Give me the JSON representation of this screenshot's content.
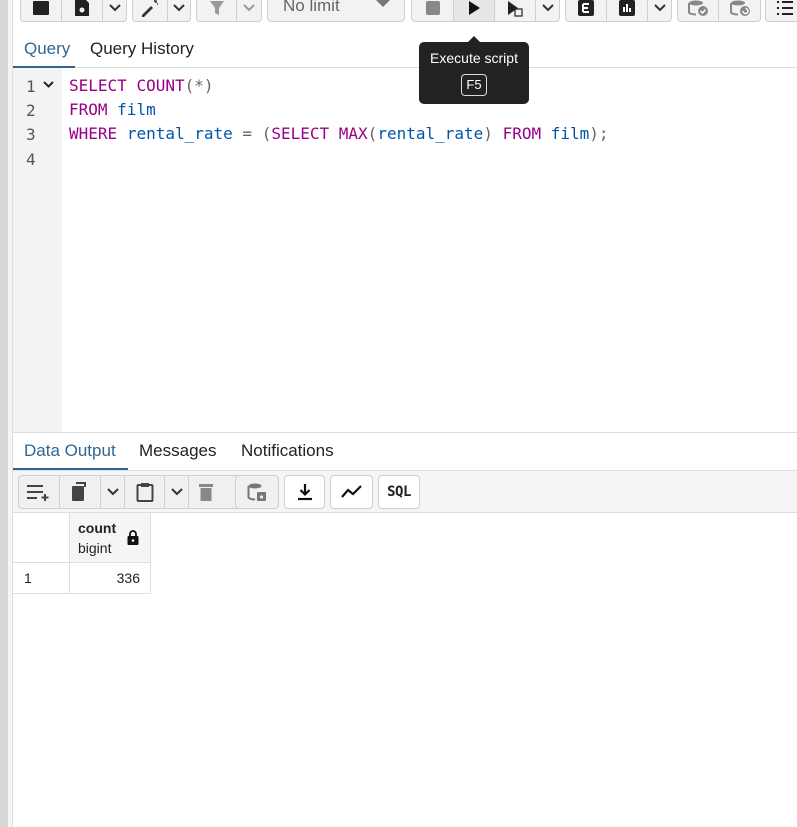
{
  "toolbar": {
    "limit_label": "No limit",
    "icons": [
      "open-file-icon",
      "save-icon",
      "chevron-down-icon",
      "edit-pen-icon",
      "chevron-down-icon",
      "filter-icon",
      "chevron-down-icon",
      "stop-icon",
      "execute-icon",
      "execute-explain-icon",
      "chevron-down-icon",
      "explain-icon",
      "explain-analyze-icon",
      "chevron-down-icon",
      "commit-icon",
      "rollback-icon",
      "macros-icon"
    ]
  },
  "tooltip": {
    "text": "Execute script",
    "shortcut": "F5"
  },
  "editor_tabs": [
    "Query",
    "Query History"
  ],
  "editor": {
    "line_numbers": [
      "1",
      "2",
      "3",
      "4"
    ],
    "lines": [
      [
        {
          "t": "SELECT",
          "c": "kw"
        },
        {
          "t": " ",
          "c": ""
        },
        {
          "t": "COUNT",
          "c": "kw"
        },
        {
          "t": "(*)",
          "c": "pu"
        }
      ],
      [
        {
          "t": "FROM",
          "c": "kw"
        },
        {
          "t": " ",
          "c": ""
        },
        {
          "t": "film",
          "c": "id"
        }
      ],
      [
        {
          "t": "WHERE",
          "c": "kw"
        },
        {
          "t": " ",
          "c": ""
        },
        {
          "t": "rental_rate",
          "c": "id"
        },
        {
          "t": " = ",
          "c": "pu"
        },
        {
          "t": "(",
          "c": "pu"
        },
        {
          "t": "SELECT",
          "c": "kw"
        },
        {
          "t": " ",
          "c": ""
        },
        {
          "t": "MAX",
          "c": "kw"
        },
        {
          "t": "(",
          "c": "pu"
        },
        {
          "t": "rental_rate",
          "c": "id"
        },
        {
          "t": ")",
          "c": "pu"
        },
        {
          "t": " ",
          "c": ""
        },
        {
          "t": "FROM",
          "c": "kw"
        },
        {
          "t": " ",
          "c": ""
        },
        {
          "t": "film",
          "c": "id"
        },
        {
          "t": ");",
          "c": "pu"
        }
      ],
      []
    ]
  },
  "output_tabs": [
    "Data Output",
    "Messages",
    "Notifications"
  ],
  "output_toolbar": {
    "sql_label": "SQL"
  },
  "result": {
    "columns": [
      {
        "name": "count",
        "type": "bigint"
      }
    ],
    "rows": [
      {
        "row_number": "1",
        "values": [
          "336"
        ]
      }
    ]
  },
  "colors": {
    "accent": "#326690",
    "keyword": "#990088",
    "identifier": "#0055aa"
  }
}
